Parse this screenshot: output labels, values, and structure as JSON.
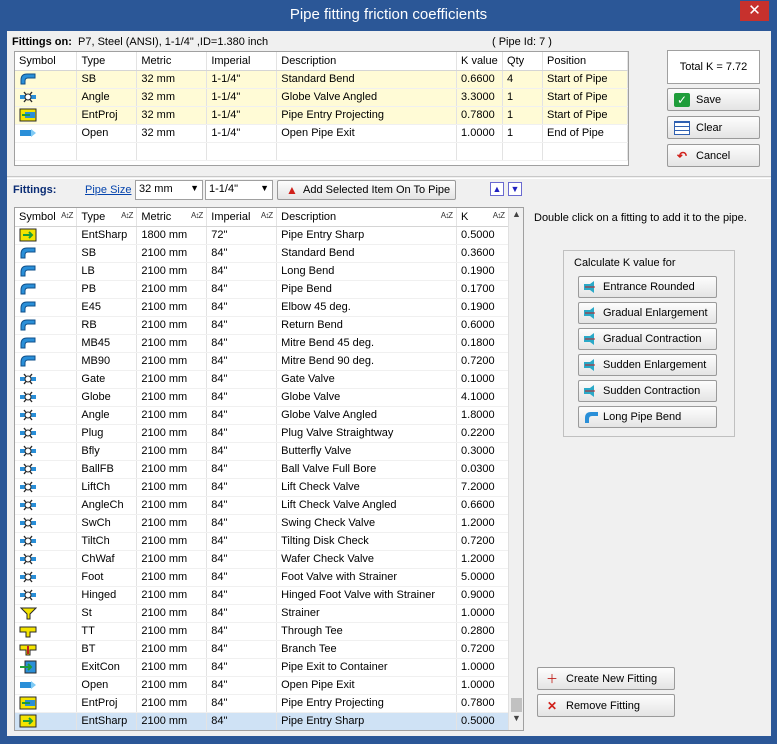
{
  "window": {
    "title": "Pipe fitting friction coefficients",
    "close_glyph": "✕"
  },
  "fittings_on": {
    "label": "Fittings on:",
    "value": "P7, Steel (ANSI), 1-1/4\" ,ID=1.380 inch",
    "pipe_id": "( Pipe Id: 7 )"
  },
  "top_table": {
    "headers": [
      "Symbol",
      "Type",
      "Metric",
      "Imperial",
      "Description",
      "K value",
      "Qty",
      "Position"
    ],
    "rows": [
      {
        "icon": "standard-bend-icon",
        "type": "SB",
        "metric": "32 mm",
        "imperial": "1-1/4\"",
        "description": "Standard Bend",
        "k": "0.6600",
        "qty": "4",
        "position": "Start of Pipe",
        "highlight": true
      },
      {
        "icon": "globe-valve-angled-icon",
        "type": "Angle",
        "metric": "32 mm",
        "imperial": "1-1/4\"",
        "description": "Globe Valve Angled",
        "k": "3.3000",
        "qty": "1",
        "position": "Start of Pipe",
        "highlight": true
      },
      {
        "icon": "pipe-entry-projecting-icon",
        "type": "EntProj",
        "metric": "32 mm",
        "imperial": "1-1/4\"",
        "description": "Pipe Entry Projecting",
        "k": "0.7800",
        "qty": "1",
        "position": "Start of Pipe",
        "highlight": true
      },
      {
        "icon": "open-pipe-exit-icon",
        "type": "Open",
        "metric": "32 mm",
        "imperial": "1-1/4\"",
        "description": "Open Pipe Exit",
        "k": "1.0000",
        "qty": "1",
        "position": "End of Pipe",
        "highlight": false
      }
    ]
  },
  "total_k": "Total K = 7.72",
  "actions": {
    "save": "Save",
    "clear": "Clear",
    "cancel": "Cancel"
  },
  "filter": {
    "label": "Fittings:",
    "pipe_size_link": "Pipe Size",
    "metric_value": "32 mm",
    "imperial_value": "1-1/4\"",
    "add_button": "Add Selected Item On To Pipe",
    "up_glyph": "▲",
    "down_glyph": "▼"
  },
  "main_table": {
    "headers": [
      "Symbol",
      "Type",
      "Metric",
      "Imperial",
      "Description",
      "K"
    ],
    "sort_glyph": "A↕Z",
    "rows": [
      {
        "icon": "pipe-entry-sharp-icon",
        "type": "EntSharp",
        "metric": "1800 mm",
        "imperial": "72\"",
        "description": "Pipe Entry Sharp",
        "k": "0.5000"
      },
      {
        "icon": "standard-bend-icon",
        "type": "SB",
        "metric": "2100 mm",
        "imperial": "84\"",
        "description": "Standard Bend",
        "k": "0.3600"
      },
      {
        "icon": "long-bend-icon",
        "type": "LB",
        "metric": "2100 mm",
        "imperial": "84\"",
        "description": "Long Bend",
        "k": "0.1900"
      },
      {
        "icon": "pipe-bend-icon",
        "type": "PB",
        "metric": "2100 mm",
        "imperial": "84\"",
        "description": "Pipe Bend",
        "k": "0.1700"
      },
      {
        "icon": "elbow-45-icon",
        "type": "E45",
        "metric": "2100 mm",
        "imperial": "84\"",
        "description": "Elbow 45 deg.",
        "k": "0.1900"
      },
      {
        "icon": "return-bend-icon",
        "type": "RB",
        "metric": "2100 mm",
        "imperial": "84\"",
        "description": "Return Bend",
        "k": "0.6000"
      },
      {
        "icon": "mitre-bend-45-icon",
        "type": "MB45",
        "metric": "2100 mm",
        "imperial": "84\"",
        "description": "Mitre Bend 45 deg.",
        "k": "0.1800"
      },
      {
        "icon": "mitre-bend-90-icon",
        "type": "MB90",
        "metric": "2100 mm",
        "imperial": "84\"",
        "description": "Mitre Bend 90 deg.",
        "k": "0.7200"
      },
      {
        "icon": "gate-valve-icon",
        "type": "Gate",
        "metric": "2100 mm",
        "imperial": "84\"",
        "description": "Gate Valve",
        "k": "0.1000"
      },
      {
        "icon": "globe-valve-icon",
        "type": "Globe",
        "metric": "2100 mm",
        "imperial": "84\"",
        "description": "Globe Valve",
        "k": "4.1000"
      },
      {
        "icon": "globe-valve-angled-icon",
        "type": "Angle",
        "metric": "2100 mm",
        "imperial": "84\"",
        "description": "Globe Valve Angled",
        "k": "1.8000"
      },
      {
        "icon": "plug-valve-icon",
        "type": "Plug",
        "metric": "2100 mm",
        "imperial": "84\"",
        "description": "Plug Valve Straightway",
        "k": "0.2200"
      },
      {
        "icon": "butterfly-valve-icon",
        "type": "Bfly",
        "metric": "2100 mm",
        "imperial": "84\"",
        "description": "Butterfly Valve",
        "k": "0.3000"
      },
      {
        "icon": "ball-valve-icon",
        "type": "BallFB",
        "metric": "2100 mm",
        "imperial": "84\"",
        "description": "Ball Valve Full Bore",
        "k": "0.0300"
      },
      {
        "icon": "lift-check-valve-icon",
        "type": "LiftCh",
        "metric": "2100 mm",
        "imperial": "84\"",
        "description": "Lift Check Valve",
        "k": "7.2000"
      },
      {
        "icon": "lift-check-valve-angled-icon",
        "type": "AngleCh",
        "metric": "2100 mm",
        "imperial": "84\"",
        "description": "Lift Check Valve Angled",
        "k": "0.6600"
      },
      {
        "icon": "swing-check-valve-icon",
        "type": "SwCh",
        "metric": "2100 mm",
        "imperial": "84\"",
        "description": "Swing Check Valve",
        "k": "1.2000"
      },
      {
        "icon": "tilting-disk-check-icon",
        "type": "TiltCh",
        "metric": "2100 mm",
        "imperial": "84\"",
        "description": "Tilting Disk Check",
        "k": "0.7200"
      },
      {
        "icon": "wafer-check-valve-icon",
        "type": "ChWaf",
        "metric": "2100 mm",
        "imperial": "84\"",
        "description": "Wafer Check Valve",
        "k": "1.2000"
      },
      {
        "icon": "foot-valve-icon",
        "type": "Foot",
        "metric": "2100 mm",
        "imperial": "84\"",
        "description": "Foot Valve with Strainer",
        "k": "5.0000"
      },
      {
        "icon": "hinged-foot-valve-icon",
        "type": "Hinged",
        "metric": "2100 mm",
        "imperial": "84\"",
        "description": "Hinged Foot Valve with Strainer",
        "k": "0.9000"
      },
      {
        "icon": "strainer-icon",
        "type": "St",
        "metric": "2100 mm",
        "imperial": "84\"",
        "description": "Strainer",
        "k": "1.0000"
      },
      {
        "icon": "through-tee-icon",
        "type": "TT",
        "metric": "2100 mm",
        "imperial": "84\"",
        "description": "Through Tee",
        "k": "0.2800"
      },
      {
        "icon": "branch-tee-icon",
        "type": "BT",
        "metric": "2100 mm",
        "imperial": "84\"",
        "description": "Branch Tee",
        "k": "0.7200"
      },
      {
        "icon": "pipe-exit-container-icon",
        "type": "ExitCon",
        "metric": "2100 mm",
        "imperial": "84\"",
        "description": "Pipe Exit to Container",
        "k": "1.0000"
      },
      {
        "icon": "open-pipe-exit-icon",
        "type": "Open",
        "metric": "2100 mm",
        "imperial": "84\"",
        "description": "Open Pipe Exit",
        "k": "1.0000"
      },
      {
        "icon": "pipe-entry-projecting-icon",
        "type": "EntProj",
        "metric": "2100 mm",
        "imperial": "84\"",
        "description": "Pipe Entry Projecting",
        "k": "0.7800"
      },
      {
        "icon": "pipe-entry-sharp-icon",
        "type": "EntSharp",
        "metric": "2100 mm",
        "imperial": "84\"",
        "description": "Pipe Entry Sharp",
        "k": "0.5000",
        "selected": true
      }
    ]
  },
  "hint": "Double click on a fitting to add it to the pipe.",
  "calc": {
    "caption": "Calculate K value for",
    "buttons": [
      "Entrance Rounded",
      "Gradual Enlargement",
      "Gradual Contraction",
      "Sudden Enlargement",
      "Sudden Contraction",
      "Long Pipe Bend"
    ]
  },
  "fitting_actions": {
    "create": "Create New Fitting",
    "remove": "Remove Fitting"
  },
  "colors": {
    "title_bar": "#2b5797",
    "close": "#c7312d",
    "highlight_row": "#fffbd6",
    "selected_row": "#cfe2f5"
  }
}
